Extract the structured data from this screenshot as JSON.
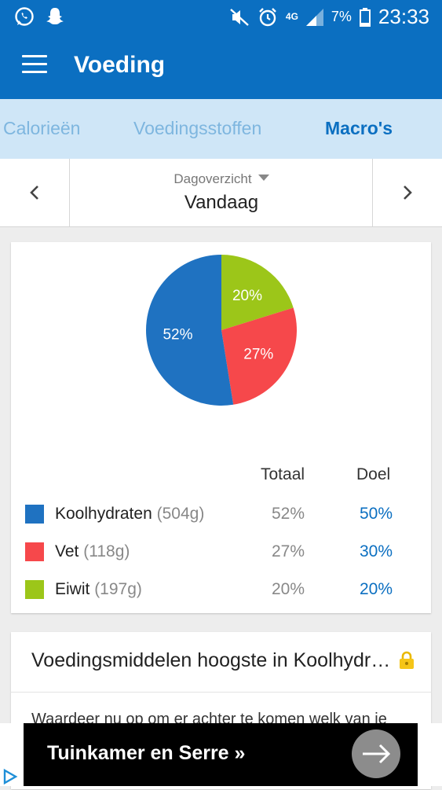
{
  "status_bar": {
    "network": "4G",
    "battery_percent": "7%",
    "time": "23:33"
  },
  "app_bar": {
    "title": "Voeding"
  },
  "tabs": [
    {
      "label": "Calorieën",
      "active": false
    },
    {
      "label": "Voedingsstoffen",
      "active": false
    },
    {
      "label": "Macro's",
      "active": true
    }
  ],
  "day_selector": {
    "label": "Dagoverzicht",
    "value": "Vandaag"
  },
  "macros": {
    "header_total": "Totaal",
    "header_goal": "Doel",
    "rows": [
      {
        "name": "Koolhydraten",
        "grams": "(504g)",
        "total": "52%",
        "goal": "50%",
        "color": "#1f72c1"
      },
      {
        "name": "Vet",
        "grams": "(118g)",
        "total": "27%",
        "goal": "30%",
        "color": "#f6484b"
      },
      {
        "name": "Eiwit",
        "grams": "(197g)",
        "total": "20%",
        "goal": "20%",
        "color": "#9cc619"
      }
    ]
  },
  "chart_data": {
    "type": "pie",
    "categories": [
      "Koolhydraten",
      "Vet",
      "Eiwit"
    ],
    "values": [
      52,
      27,
      20
    ],
    "labels": [
      "52%",
      "27%",
      "20%"
    ],
    "colors": [
      "#1f72c1",
      "#f6484b",
      "#9cc619"
    ]
  },
  "foods_card": {
    "title": "Voedingsmiddelen hoogste in Koolhydraten",
    "description": "Waardeer nu op om er achter te komen welk van je"
  },
  "ad": {
    "text": "Tuinkamer en Serre »"
  },
  "icons": [
    "whatsapp-icon",
    "snapchat-icon",
    "mute-icon",
    "alarm-icon",
    "signal-icon",
    "battery-icon",
    "menu-icon",
    "chevron-left-icon",
    "chevron-right-icon",
    "lock-icon",
    "arrow-right-icon",
    "adchoices-icon"
  ],
  "colors": {
    "primary": "#0b6fc1",
    "tab_bar": "#cfe6f7"
  }
}
